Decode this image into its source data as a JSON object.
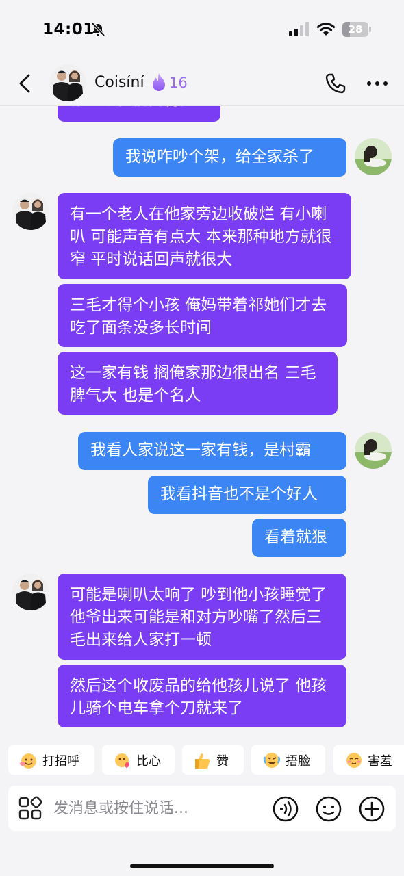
{
  "status_bar": {
    "time": "14:01",
    "battery": "28",
    "battery_level": 0.28
  },
  "header": {
    "name": "Coisíní",
    "streak": "16"
  },
  "messages": [
    {
      "side": "left",
      "text": "你一家他们闹得起"
    },
    {
      "side": "right",
      "text": "我说咋吵个架，给全家杀了"
    },
    {
      "side": "left",
      "text": "有一个老人在他家旁边收破烂 有小喇叭 可能声音有点大 本来那种地方就很窄 平时说话回声就很大"
    },
    {
      "side": "left",
      "text": "三毛才得个小孩 俺妈带着祁她们才去吃了面条没多长时间"
    },
    {
      "side": "left",
      "text": "这一家有钱 搁俺家那边很出名 三毛脾气大 也是个名人"
    },
    {
      "side": "right",
      "text": "我看人家说这一家有钱，是村霸"
    },
    {
      "side": "right",
      "text": "我看抖音也不是个好人"
    },
    {
      "side": "right",
      "text": "看着就狠"
    },
    {
      "side": "left",
      "text": "可能是喇叭太响了 吵到他小孩睡觉了 他爷出来可能是和对方吵嘴了然后三毛出来给人家打一顿"
    },
    {
      "side": "left",
      "text": "然后这个收废品的给他孩儿说了 他孩儿骑个电车拿个刀就来了"
    }
  ],
  "quick_replies": [
    {
      "label": "打招呼",
      "icon": "wave-emoji-icon"
    },
    {
      "label": "比心",
      "icon": "heart-hands-emoji-icon"
    },
    {
      "label": "赞",
      "icon": "thumbs-up-emoji-icon"
    },
    {
      "label": "捂脸",
      "icon": "facepalm-emoji-icon"
    },
    {
      "label": "害羞",
      "icon": "shy-emoji-icon"
    }
  ],
  "composer": {
    "placeholder": "发消息或按住说话..."
  },
  "colors": {
    "sent": "#3b86f4",
    "received": "#7a3df4",
    "background": "#f4f4f6",
    "accent": "#9b6cf0"
  }
}
